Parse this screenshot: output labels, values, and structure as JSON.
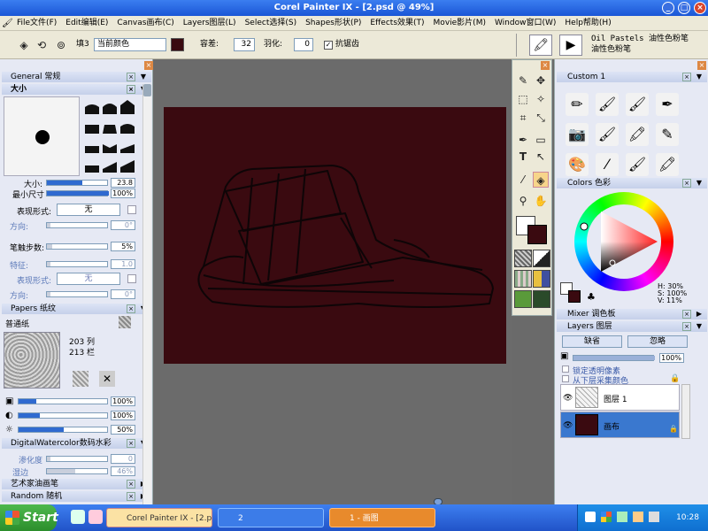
{
  "app": {
    "title": "Corel Painter IX - [2.psd @ 49%]"
  },
  "menu": [
    "File文件(F)",
    "Edit编辑(E)",
    "Canvas画布(C)",
    "Layers图层(L)",
    "Select选择(S)",
    "Shapes形状(P)",
    "Effects效果(T)",
    "Movie影片(M)",
    "Window窗口(W)",
    "Help帮助(H)"
  ],
  "propbar": {
    "fill_label": "填3",
    "fill_value": "当前颜色",
    "tolerance_label": "容差:",
    "tolerance_value": "32",
    "feather_label": "羽化:",
    "feather_value": "0",
    "antialias_label": "抗锯齿",
    "brush_category": "Oil Pastels",
    "brush_category_cn": "油性色粉笔",
    "brush_variant": "油性色粉笔"
  },
  "left_palette": {
    "general_header": "General 常规",
    "size_header": "大小",
    "size_label": "大小:",
    "size_value": "23.8",
    "min_size_label": "最小尺寸",
    "min_size_value": "100%",
    "expression_label": "表现形式:",
    "expression_value": "无",
    "direction_label": "方向:",
    "direction_value": "0°",
    "stroke_steps_label": "笔触步数:",
    "stroke_steps_value": "5%",
    "feature_label": "特征:",
    "feature_value": "1.0",
    "expression2_label": "表现形式:",
    "expression2_value": "无",
    "direction2_label": "方向:",
    "direction2_value": "0°",
    "papers_header": "Papers 纸纹",
    "paper_name": "普通纸",
    "paper_cols": "203 列",
    "paper_rows": "213 栏",
    "paper_scale_value": "100%",
    "paper_contrast_value": "100%",
    "paper_brightness_value": "50%",
    "watercolor_header": "DigitalWatercolor数码水彩",
    "diffusion_label": "渗化度",
    "diffusion_value": "0",
    "wet_fringe_label": "湿边",
    "wet_fringe_value": "46%",
    "artist_oils_header": "艺术家油画笔",
    "random_header": "Random 随机"
  },
  "right_palette": {
    "custom_header": "Custom 1",
    "colors_header": "Colors 色彩",
    "hsv_h": "H: 30%",
    "hsv_s": "S: 100%",
    "hsv_v": "V: 11%",
    "mixer_header": "Mixer 调色板",
    "layers_header": "Layers 图层",
    "composite_method": "缺省",
    "composite_depth": "忽略",
    "opacity_value": "100%",
    "preserve_transparency": "锁定透明像素",
    "pick_up_color": "从下层采集颜色",
    "layers": [
      {
        "name": "图层 1",
        "selected": false
      },
      {
        "name": "画布",
        "selected": true
      }
    ]
  },
  "taskbar": {
    "start_label": "Start",
    "tasks": [
      {
        "label": "Corel Painter IX - [2.p...",
        "active": true
      },
      {
        "label": "2",
        "active": false
      },
      {
        "label": "1 - 画图",
        "active": false
      }
    ],
    "clock": "10:28"
  },
  "colors": {
    "canvas_bg": "#3a0a10",
    "primary_color": "#3a0a10",
    "title_blue": "#1a56d6"
  }
}
